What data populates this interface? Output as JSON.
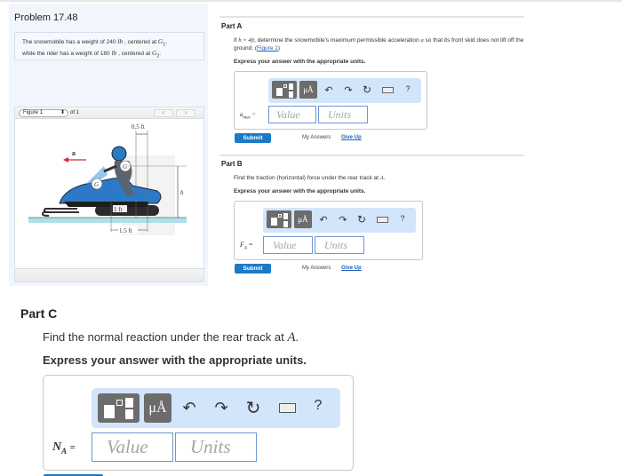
{
  "problem": {
    "title": "Problem 17.48",
    "statement_line1_pre": "The snowmobile has a weight of 240 ",
    "statement_unit1": "lb",
    "statement_line1_mid": " , centered at ",
    "statement_g1": "G",
    "statement_g1_sub": "1",
    "statement_line2_pre": "while the rider has a weight of 180 ",
    "statement_unit2": "lb",
    "statement_line2_mid": " , centered at ",
    "statement_g2": "G",
    "statement_g2_sub": "2"
  },
  "figure": {
    "selector_value": "Figure 1",
    "of_label": "of 1",
    "prev_icon": "chevron-left-icon",
    "next_icon": "chevron-right-icon",
    "labels": {
      "top_dim": "0.5 ft",
      "accel": "a",
      "g1": "G",
      "g2": "G",
      "h": "h",
      "one_ft": "1 ft",
      "a_point": "A",
      "bottom_dim": "1.5 ft"
    }
  },
  "parts": [
    {
      "label": "Part A",
      "text_pre": "If ",
      "math": "h = 4ft",
      "text_post": ", determine the snowmobile's maximum permissible acceleration ",
      "math2": "a",
      "text_post2": " so that its front skid does not lift off the ground.  (",
      "link": "Figure 1",
      "text_end": ")",
      "express": "Express your answer with the appropriate units.",
      "var": "a",
      "var_sub": "max",
      "eq": "=",
      "value_placeholder": "Value",
      "units_placeholder": "Units",
      "submit": "Submit",
      "my_answers": "My Answers",
      "give_up": "Give Up"
    },
    {
      "label": "Part B",
      "text_pre": "Find the traction (horizontal) force under the rear track at ",
      "math": "A",
      "text_post": ".",
      "express": "Express your answer with the appropriate units.",
      "var": "F",
      "var_sub": "A",
      "eq": "=",
      "value_placeholder": "Value",
      "units_placeholder": "Units",
      "submit": "Submit",
      "my_answers": "My Answers",
      "give_up": "Give Up"
    },
    {
      "label": "Part C",
      "text_pre": "Find the normal reaction under the rear track at ",
      "math": "A",
      "text_post": ".",
      "express": "Express your answer with the appropriate units.",
      "var": "N",
      "var_sub": "A",
      "eq": "=",
      "value_placeholder": "Value",
      "units_placeholder": "Units"
    }
  ],
  "toolbar": {
    "template_icon": "fraction-template-icon",
    "units_label": "μÅ",
    "undo": "↶",
    "redo": "↷",
    "reset": "↻",
    "keyboard_icon": "keyboard-icon",
    "help": "?"
  },
  "colors": {
    "accent": "#1a7ac8",
    "link": "#1f5fb5",
    "toolbar_bg": "#d3e5fa",
    "field_border": "#6f96d3"
  }
}
